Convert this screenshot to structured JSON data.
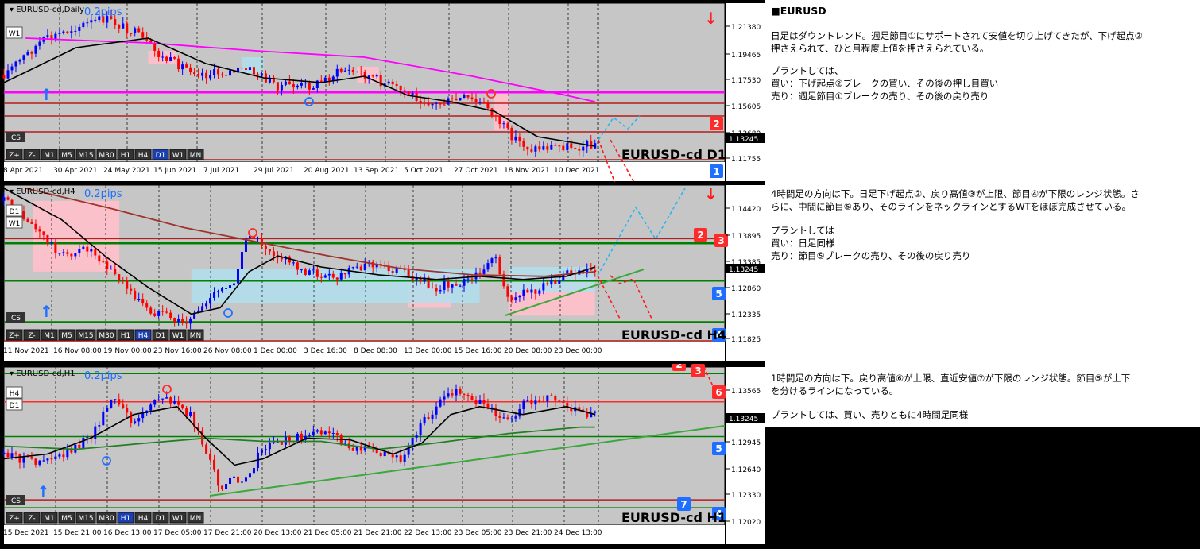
{
  "colors": {
    "background": "#c6c6c6",
    "grid": "#000000",
    "candle_up": "#0000ff",
    "candle_down": "#ff0000",
    "ma_fast": "#000000",
    "ma_slow_daily": "#ff00ff",
    "ma_slow_h4": "#a0322b",
    "ma_slow_h1": "#208020",
    "resistance": "#b21f1f",
    "support": "#008000",
    "up_arrow": "#1e90ff",
    "down_arrow": "#ff0000"
  },
  "panels": [
    {
      "id": "daily",
      "title": "EURUSD-cd,Daily",
      "spread": "0.2pips",
      "watermark": "EURUSD-cd D1",
      "price_badge": "1.13245",
      "y_labels": [
        "1.21380",
        "1.19465",
        "1.17530",
        "1.15605",
        "1.13680",
        "1.11755"
      ],
      "x_labels": [
        "8 Apr 2021",
        "30 Apr 2021",
        "24 May 2021",
        "15 Jun 2021",
        "7 Jul 2021",
        "29 Jul 2021",
        "20 Aug 2021",
        "13 Sep 2021",
        "5 Oct 2021",
        "27 Oct 2021",
        "18 Nov 2021",
        "10 Dec 2021"
      ],
      "left_buttons": [
        "W1"
      ],
      "timeframes": [
        "Z+",
        "Z-",
        "M1",
        "M5",
        "M15",
        "M30",
        "H1",
        "H4",
        "D1",
        "W1",
        "MN"
      ],
      "active_timeframe": "D1",
      "cs_label": "CS",
      "level_markers": [
        "2",
        "1"
      ]
    },
    {
      "id": "h4",
      "title": "EURUSD-cd,H4",
      "spread": "0.2pips",
      "watermark": "EURUSD-cd H4",
      "price_badge": "1.13245",
      "y_labels": [
        "1.14420",
        "1.13895",
        "1.13385",
        "1.12860",
        "1.12335",
        "1.11825"
      ],
      "x_labels": [
        "11 Nov 2021",
        "16 Nov 08:00",
        "19 Nov 00:00",
        "23 Nov 16:00",
        "26 Nov 08:00",
        "1 Dec 00:00",
        "3 Dec 16:00",
        "8 Dec 08:00",
        "13 Dec 00:00",
        "15 Dec 16:00",
        "20 Dec 08:00",
        "23 Dec 00:00"
      ],
      "left_buttons": [
        "D1",
        "W1"
      ],
      "timeframes": [
        "Z+",
        "Z-",
        "M1",
        "M5",
        "M15",
        "M30",
        "H1",
        "H4",
        "D1",
        "W1",
        "MN"
      ],
      "active_timeframe": "H4",
      "cs_label": "CS",
      "level_markers": [
        "2",
        "3",
        "5",
        "4"
      ]
    },
    {
      "id": "h1",
      "title": "EURUSD-cd,H1",
      "spread": "0.2pips",
      "watermark": "EURUSD-cd H1",
      "price_badge": "1.13245",
      "y_labels": [
        "1.13565",
        "1.13245",
        "1.12945",
        "1.12640",
        "1.12330",
        "1.12020"
      ],
      "x_labels": [
        "15 Dec 2021",
        "15 Dec 21:00",
        "16 Dec 13:00",
        "17 Dec 05:00",
        "17 Dec 21:00",
        "20 Dec 13:00",
        "21 Dec 05:00",
        "21 Dec 21:00",
        "22 Dec 13:00",
        "23 Dec 05:00",
        "23 Dec 21:00",
        "24 Dec 13:00"
      ],
      "left_buttons": [
        "H4",
        "D1"
      ],
      "timeframes": [
        "Z+",
        "Z-",
        "M1",
        "M5",
        "M15",
        "M30",
        "H1",
        "H4",
        "D1",
        "W1",
        "MN"
      ],
      "active_timeframe": "H1",
      "cs_label": "CS",
      "level_markers": [
        "2",
        "3",
        "6",
        "5",
        "7",
        "4"
      ]
    }
  ],
  "notes": {
    "header": "■EURUSD",
    "daily_text": "日足はダウントレンド。週足節目①にサポートされて安値を切り上げてきたが、下げ起点②\n押さえられて、ひと月程度上値を押さえられている。",
    "daily_plan": "プラントしては、\n買い：下げ起点②ブレークの買い、その後の押し目買い\n売り：週足節目①ブレークの売り、その後の戻り売り",
    "h4_text": "4時間足の方向は下。日足下げ起点②、戻り高値③が上限、節目④が下限のレンジ状態。さ\nらに、中間に節目⑤あり、そのラインをネックラインとするWTをほぼ完成させている。",
    "h4_plan": "プラントしては\n買い：日足同様\n売り：節目⑤ブレークの売り、その後の戻り売り",
    "h1_text": "1時間足の方向は下。戻り高値⑥が上限、直近安値⑦が下限のレンジ状態。節目⑤が上下\nを分けるラインになっている。",
    "h1_plan": "プラントしては、買い、売りともに4時間足同様"
  }
}
